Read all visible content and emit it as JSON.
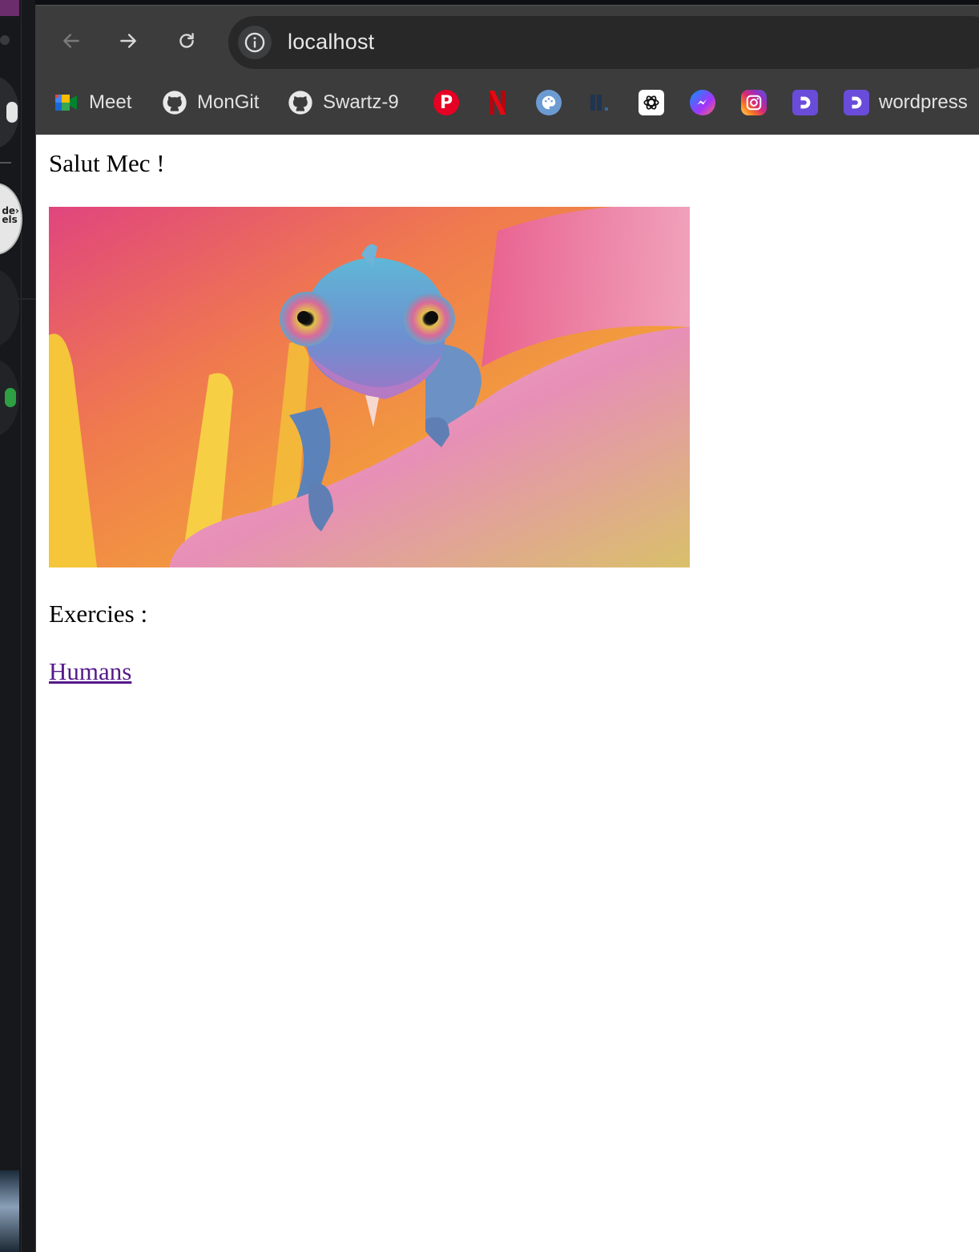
{
  "browser": {
    "url": "localhost",
    "bookmarks": [
      {
        "label": "Meet",
        "icon": "google-meet-icon"
      },
      {
        "label": "MonGit",
        "icon": "github-icon"
      },
      {
        "label": "Swartz-9",
        "icon": "github-icon"
      },
      {
        "label": "",
        "icon": "pinterest-icon"
      },
      {
        "label": "",
        "icon": "netflix-icon"
      },
      {
        "label": "",
        "icon": "palette-icon"
      },
      {
        "label": "",
        "icon": "dark-site-icon"
      },
      {
        "label": "",
        "icon": "chatgpt-icon"
      },
      {
        "label": "",
        "icon": "messenger-icon"
      },
      {
        "label": "",
        "icon": "instagram-icon"
      },
      {
        "label": "",
        "icon": "purple-d-icon"
      },
      {
        "label": "wordpress",
        "icon": "purple-d-icon"
      }
    ]
  },
  "page": {
    "greeting": "Salut Mec !",
    "image_subject": "chameleon-on-flower-photo",
    "section_title": "Exercies :",
    "link_label": "Humans"
  },
  "colors": {
    "link_visited": "#551a8b",
    "toolbar": "#3c3c3c",
    "urlbar": "#282828"
  }
}
